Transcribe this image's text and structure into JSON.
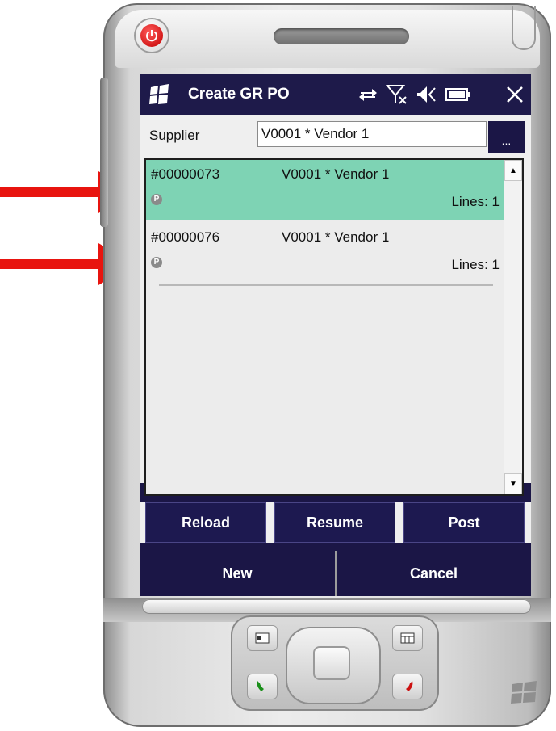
{
  "window": {
    "title": "Create GR PO"
  },
  "status_icons": [
    "sync-icon",
    "no-signal-icon",
    "volume-muted-icon",
    "battery-icon",
    "close-icon"
  ],
  "form": {
    "supplier_label": "Supplier",
    "supplier_value": "V0001 * Vendor 1",
    "lookup_label": "..."
  },
  "list": {
    "rows": [
      {
        "doc": "#00000073",
        "vendor": "V0001 * Vendor 1",
        "badge": "P",
        "lines": "Lines: 1",
        "selected": true
      },
      {
        "doc": "#00000076",
        "vendor": "V0001 * Vendor 1",
        "badge": "P",
        "lines": "Lines: 1",
        "selected": false
      }
    ]
  },
  "buttons": {
    "reload": "Reload",
    "resume": "Resume",
    "post": "Post",
    "new": "New",
    "cancel": "Cancel"
  },
  "colors": {
    "titlebar": "#1e1a4a",
    "selected_row": "#7ed3b4",
    "button": "#1d1950",
    "arrow": "#e8140f",
    "power": "#d90000"
  }
}
